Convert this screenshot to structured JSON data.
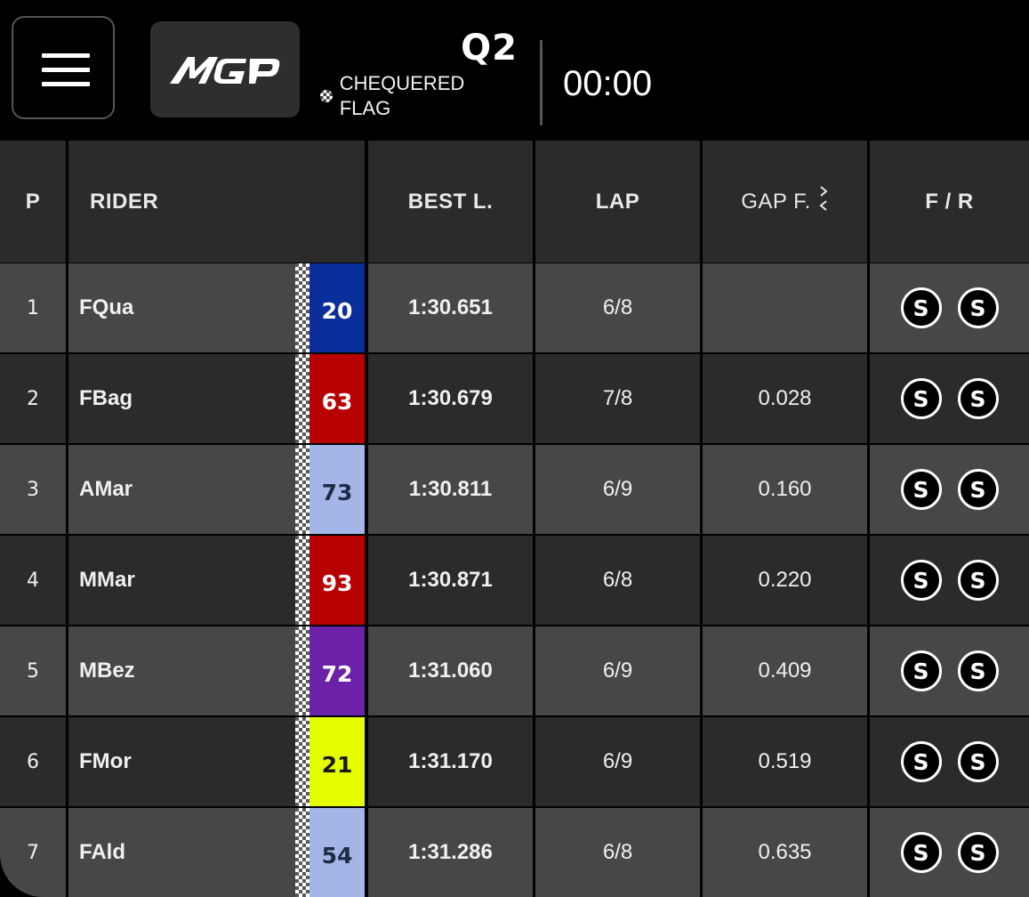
{
  "header": {
    "menu_icon": "hamburger-menu-icon",
    "logo_text": "MGP",
    "session": "Q2",
    "status": "CHEQUERED FLAG",
    "status_icon": "chequered-flag-icon",
    "timer": "00:00"
  },
  "table": {
    "headers": {
      "position": "P",
      "rider": "RIDER",
      "best_lap": "BEST L.",
      "lap": "LAP",
      "gap": "GAP F.",
      "front_rear": "F / R"
    },
    "sort_icon": "sort-toggle-icon",
    "rows": [
      {
        "pos": "1",
        "rider": "FQua",
        "number": "20",
        "number_bg": "#0b2f9a",
        "number_color": "#ffffff",
        "best": "1:30.651",
        "lap": "6/8",
        "gap": "",
        "front": "S",
        "rear": "S"
      },
      {
        "pos": "2",
        "rider": "FBag",
        "number": "63",
        "number_bg": "#b70000",
        "number_color": "#ffffff",
        "best": "1:30.679",
        "lap": "7/8",
        "gap": "0.028",
        "front": "S",
        "rear": "S"
      },
      {
        "pos": "3",
        "rider": "AMar",
        "number": "73",
        "number_bg": "#a4b6e8",
        "number_color": "#1f2a44",
        "best": "1:30.811",
        "lap": "6/9",
        "gap": "0.160",
        "front": "S",
        "rear": "S"
      },
      {
        "pos": "4",
        "rider": "MMar",
        "number": "93",
        "number_bg": "#b70000",
        "number_color": "#ffffff",
        "best": "1:30.871",
        "lap": "6/8",
        "gap": "0.220",
        "front": "S",
        "rear": "S"
      },
      {
        "pos": "5",
        "rider": "MBez",
        "number": "72",
        "number_bg": "#6b21a8",
        "number_color": "#ffffff",
        "best": "1:31.060",
        "lap": "6/9",
        "gap": "0.409",
        "front": "S",
        "rear": "S"
      },
      {
        "pos": "6",
        "rider": "FMor",
        "number": "21",
        "number_bg": "#e5ff00",
        "number_color": "#1a1a1a",
        "best": "1:31.170",
        "lap": "6/9",
        "gap": "0.519",
        "front": "S",
        "rear": "S"
      },
      {
        "pos": "7",
        "rider": "FAld",
        "number": "54",
        "number_bg": "#a4b6e8",
        "number_color": "#1f2a44",
        "best": "1:31.286",
        "lap": "6/8",
        "gap": "0.635",
        "front": "S",
        "rear": "S"
      }
    ]
  },
  "colors": {
    "row_light": "#474747",
    "row_dark": "#2b2b2b",
    "header_bg": "#2b2b2b",
    "background": "#000000"
  }
}
